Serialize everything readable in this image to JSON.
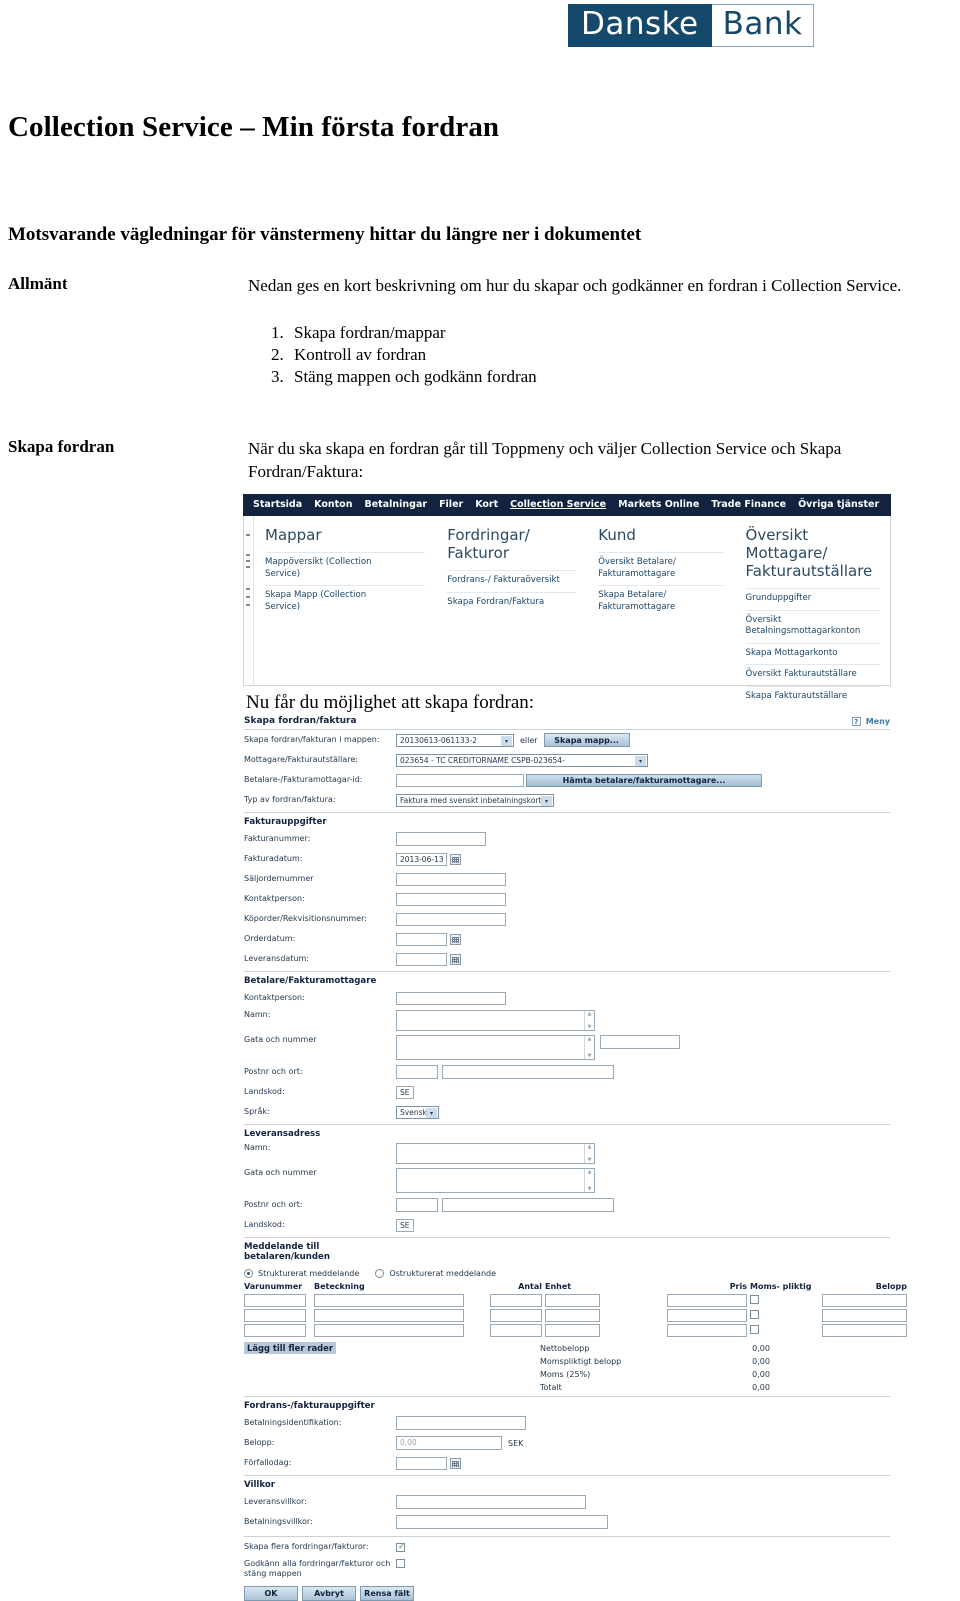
{
  "brand": {
    "logo_left": "Danske",
    "logo_right": "Bank",
    "logo_bg": "#14496b"
  },
  "document": {
    "title": "Collection Service – Min första fordran",
    "subtitle": "Motsvarande vägledningar för vänstermeny hittar du längre ner i dokumentet",
    "sections": [
      {
        "label": "Allmänt",
        "paragraph": "Nedan ges en kort beskrivning om hur du skapar och godkänner en fordran i Collection Service.",
        "steps": [
          "Skapa fordran/mappar",
          "Kontroll av fordran",
          "Stäng mappen och godkänn fordran"
        ]
      },
      {
        "label": "Skapa fordran",
        "paragraph": "När du ska skapa en fordran går till Toppmeny och väljer Collection Service och Skapa Fordran/Faktura:"
      }
    ],
    "caption_form": "Nu får du möjlighet att skapa fordran:"
  },
  "nav": {
    "items": [
      {
        "label": "Startsida",
        "active": false
      },
      {
        "label": "Konton",
        "active": false
      },
      {
        "label": "Betalningar",
        "active": false
      },
      {
        "label": "Filer",
        "active": false
      },
      {
        "label": "Kort",
        "active": false
      },
      {
        "label": "Collection Service",
        "active": true
      },
      {
        "label": "Markets Online",
        "active": false
      },
      {
        "label": "Trade Finance",
        "active": false
      },
      {
        "label": "Övriga tjänster",
        "active": false
      }
    ],
    "columns": [
      {
        "title": "Mappar",
        "links": [
          "Mappöversikt (Collection\nService)",
          "Skapa Mapp (Collection\nService)"
        ]
      },
      {
        "title": "Fordringar/\nFakturor",
        "links": [
          "Fordrans-/ Fakturaöversikt",
          "Skapa Fordran/Faktura"
        ]
      },
      {
        "title": "Kund",
        "links": [
          "Översikt Betalare/\nFakturamottagare",
          "Skapa Betalare/\nFakturamottagare"
        ]
      },
      {
        "title": "Översikt Mottagare/\nFakturautställare",
        "links": [
          "Grunduppgifter",
          "Översikt\nBetalningsmottagarkonton",
          "Skapa Mottagarkonto",
          "Översikt Fakturautställare",
          "Skapa Fakturautställare"
        ]
      }
    ]
  },
  "form": {
    "header": {
      "title": "Skapa fordran/faktura",
      "menu_label": "Meny",
      "help_glyph": "?"
    },
    "top": {
      "folder_label": "Skapa fordran/fakturan i mappen:",
      "folder_value": "20130613-061133-2",
      "or_label": "eller",
      "create_folder_button": "Skapa mapp...",
      "recipient_label": "Mottagare/Fakturautställare:",
      "recipient_value": "023654     - TC    CREDITORNAME CSPB-023654-",
      "payer_id_label": "Betalare-/Fakturamottagar-id:",
      "payer_id_value": "",
      "fetch_payer_button": "Hämta betalare/fakturamottagare...",
      "type_label": "Typ av fordran/faktura:",
      "type_value": "Faktura med svenskt inbetalningskort"
    },
    "invoice_section": {
      "heading": "Fakturauppgifter",
      "fields": [
        {
          "label": "Fakturanummer:",
          "value": ""
        },
        {
          "label": "Fakturadatum:",
          "value": "2013-06-13"
        },
        {
          "label": "Säljordernummer",
          "value": ""
        },
        {
          "label": "Kontaktperson:",
          "value": ""
        },
        {
          "label": "Köporder/Rekvisitionsnummer:",
          "value": ""
        },
        {
          "label": "Orderdatum:",
          "value": ""
        },
        {
          "label": "Leveransdatum:",
          "value": ""
        }
      ]
    },
    "payer_section": {
      "heading": "Betalare/Fakturamottagare",
      "contact_label": "Kontaktperson:",
      "contact_value": "",
      "name_label": "Namn:",
      "name_value": "",
      "street_label": "Gata och nummer",
      "street_value": "",
      "street_extra_value": "",
      "zip_city_label": "Postnr och ort:",
      "zip_value": "",
      "city_value": "",
      "country_label": "Landskod:",
      "country_value": "SE",
      "language_label": "Språk:",
      "language_value": "Svenska"
    },
    "delivery_section": {
      "heading": "Leveransadress",
      "name_label": "Namn:",
      "name_value": "",
      "street_label": "Gata och nummer",
      "street_value": "",
      "zip_city_label": "Postnr och ort:",
      "zip_value": "",
      "city_value": "",
      "country_label": "Landskod:",
      "country_value": "SE"
    },
    "message_section": {
      "heading": "Meddelande till\nbetalaren/kunden",
      "option_structured": "Strukturerat meddelande",
      "option_unstructured": "Ostrukturerat meddelande",
      "selected": "Strukturerat meddelande"
    },
    "items_table": {
      "columns": [
        "Varunummer",
        "Beteckning",
        "Antal",
        "Enhet",
        "Pris",
        "Moms- pliktig",
        "Belopp"
      ],
      "rows": [
        {
          "varunummer": "",
          "beteckning": "",
          "antal": "",
          "enhet": "",
          "pris": "",
          "moms": false,
          "belopp": ""
        },
        {
          "varunummer": "",
          "beteckning": "",
          "antal": "",
          "enhet": "",
          "pris": "",
          "moms": false,
          "belopp": ""
        },
        {
          "varunummer": "",
          "beteckning": "",
          "antal": "",
          "enhet": "",
          "pris": "",
          "moms": false,
          "belopp": ""
        }
      ],
      "add_rows_button": "Lägg till fler rader",
      "totals": [
        {
          "label": "Nettobelopp",
          "value": "0,00"
        },
        {
          "label": "Momspliktigt belopp",
          "value": "0,00"
        },
        {
          "label": "Moms (25%)",
          "value": "0,00"
        },
        {
          "label": "Totalt",
          "value": "0,00"
        }
      ]
    },
    "claim_section": {
      "heading": "Fordrans-/fakturauppgifter",
      "payment_id_label": "Betalningsidentifikation:",
      "payment_id_value": "",
      "amount_label": "Belopp:",
      "amount_value": "0,00",
      "currency": "SEK",
      "due_date_label": "Förfallodag:",
      "due_date_value": ""
    },
    "terms_section": {
      "heading": "Villkor",
      "delivery_terms_label": "Leveransvillkor:",
      "delivery_terms_value": "",
      "payment_terms_label": "Betalningsvillkor:",
      "payment_terms_value": ""
    },
    "options": {
      "create_more_label": "Skapa flera fordringar/fakturor:",
      "create_more_checked": true,
      "approve_all_label": "Godkänn alla fordringar/fakturor och\nstäng mappen",
      "approve_all_checked": false
    },
    "buttons": {
      "ok": "OK",
      "cancel": "Avbryt",
      "clear": "Rensa fält"
    }
  }
}
